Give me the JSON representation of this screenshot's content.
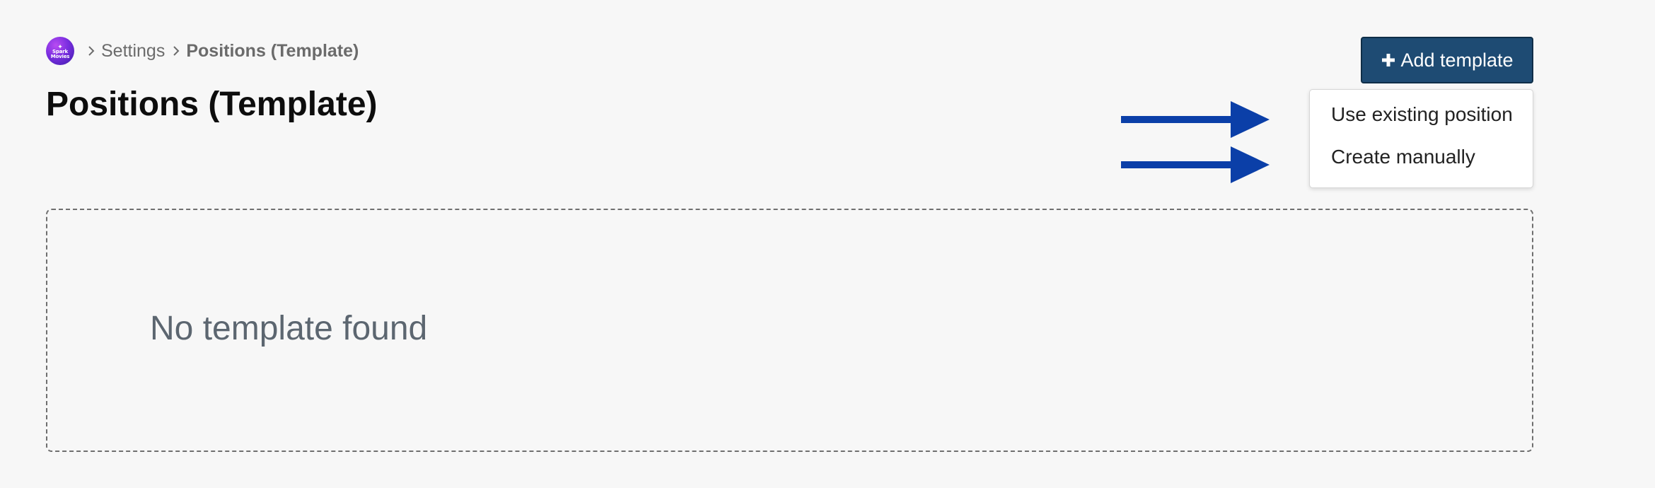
{
  "breadcrumb": {
    "logo_text": "Spark Movies",
    "items": [
      {
        "label": "Settings"
      },
      {
        "label": "Positions (Template)"
      }
    ]
  },
  "page": {
    "title": "Positions (Template)"
  },
  "actions": {
    "add_template_label": "Add template",
    "add_template_icon": "plus-icon"
  },
  "dropdown": {
    "items": [
      {
        "label": "Use existing position"
      },
      {
        "label": "Create manually"
      }
    ]
  },
  "annotations": {
    "arrow_color": "#0b3fa8"
  },
  "empty_state": {
    "message": "No template found"
  },
  "colors": {
    "background": "#f7f7f7",
    "primary_button": "#1e4b73",
    "muted_text": "#5c6670"
  }
}
